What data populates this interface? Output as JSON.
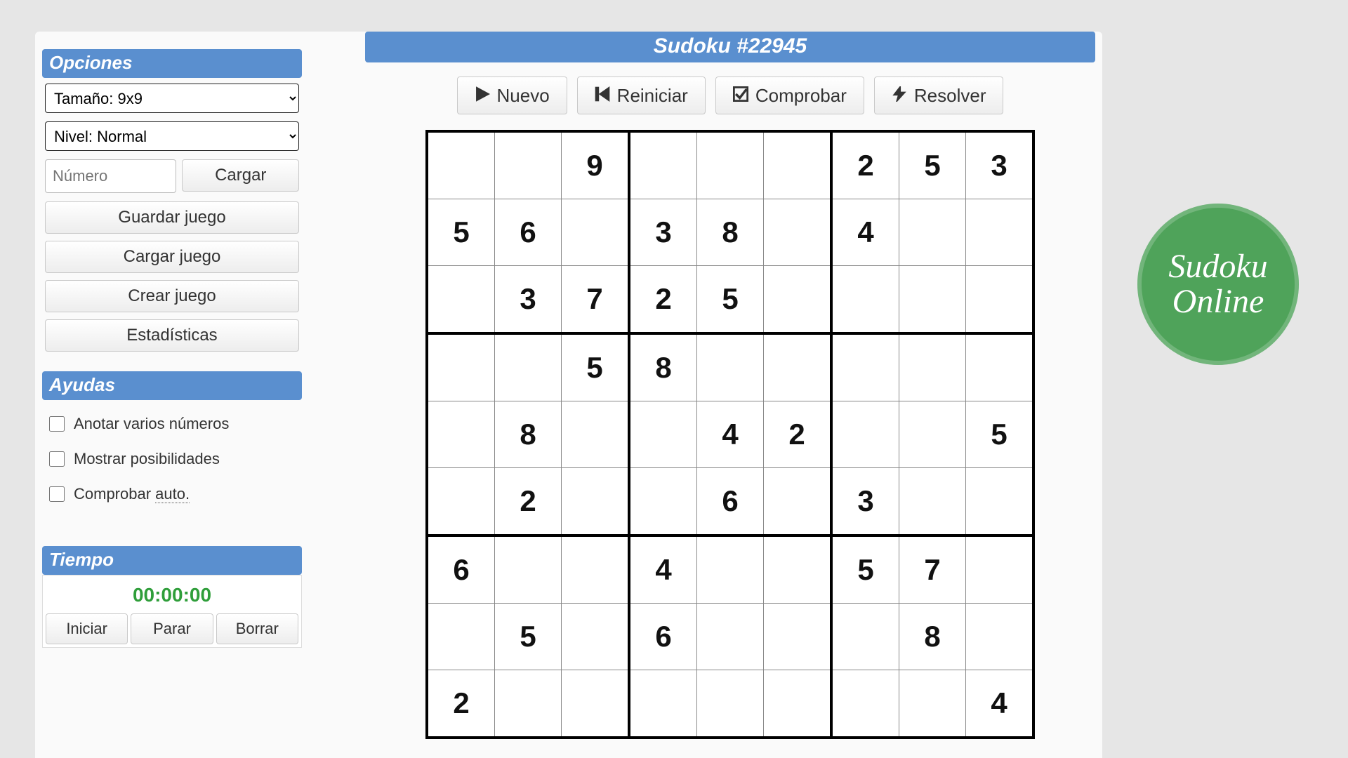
{
  "title": "Sudoku #22945",
  "logo": {
    "line1": "Sudoku",
    "line2": "Online"
  },
  "toolbar": {
    "new": "Nuevo",
    "restart": "Reiniciar",
    "check": "Comprobar",
    "solve": "Resolver"
  },
  "options": {
    "header": "Opciones",
    "size_label": "Tamaño: 9x9",
    "level_label": "Nivel: Normal",
    "number_placeholder": "Número",
    "load": "Cargar",
    "save_game": "Guardar juego",
    "load_game": "Cargar juego",
    "create_game": "Crear juego",
    "stats": "Estadísticas"
  },
  "helps": {
    "header": "Ayudas",
    "annotate": "Anotar varios números",
    "show_poss": "Mostrar posibilidades",
    "auto_check_prefix": "Comprobar ",
    "auto_check_suffix": "auto."
  },
  "time": {
    "header": "Tiempo",
    "value": "00:00:00",
    "start": "Iniciar",
    "stop": "Parar",
    "clear": "Borrar"
  },
  "board": [
    [
      "",
      "",
      "9",
      "",
      "",
      "",
      "2",
      "5",
      "3"
    ],
    [
      "5",
      "6",
      "",
      "3",
      "8",
      "",
      "4",
      "",
      ""
    ],
    [
      "",
      "3",
      "7",
      "2",
      "5",
      "",
      "",
      "",
      ""
    ],
    [
      "",
      "",
      "5",
      "8",
      "",
      "",
      "",
      "",
      ""
    ],
    [
      "",
      "8",
      "",
      "",
      "4",
      "2",
      "",
      "",
      "5"
    ],
    [
      "",
      "2",
      "",
      "",
      "6",
      "",
      "3",
      "",
      ""
    ],
    [
      "6",
      "",
      "",
      "4",
      "",
      "",
      "5",
      "7",
      ""
    ],
    [
      "",
      "5",
      "",
      "6",
      "",
      "",
      "",
      "8",
      ""
    ],
    [
      "2",
      "",
      "",
      "",
      "",
      "",
      "",
      "",
      "4"
    ]
  ]
}
